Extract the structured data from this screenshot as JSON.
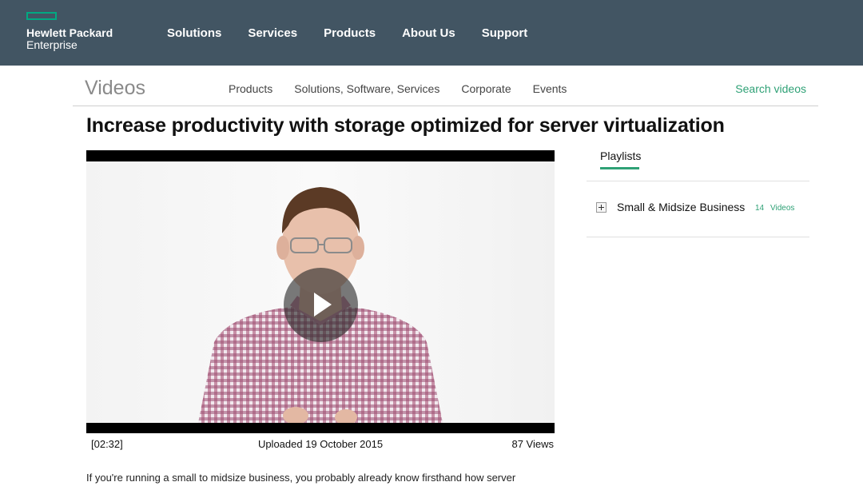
{
  "header": {
    "logo_line1": "Hewlett Packard",
    "logo_line2": "Enterprise",
    "nav": [
      "Solutions",
      "Services",
      "Products",
      "About Us",
      "Support"
    ]
  },
  "subnav": {
    "title": "Videos",
    "links": [
      "Products",
      "Solutions, Software, Services",
      "Corporate",
      "Events"
    ],
    "search_label": "Search videos"
  },
  "video": {
    "title": "Increase productivity with storage optimized for server virtualization",
    "duration": "[02:32]",
    "uploaded": "Uploaded 19 October 2015",
    "views": "87 Views",
    "description": "If you're running a small to midsize business, you probably already know firsthand how server"
  },
  "sidebar": {
    "tab": "Playlists",
    "playlist": {
      "name": "Small & Midsize Business",
      "count": "14",
      "count_label": "Videos"
    }
  },
  "colors": {
    "header_bg": "#425563",
    "accent_green": "#2fa176",
    "brand_green": "#01a982"
  },
  "icons": {
    "play": "play-icon",
    "expand": "plus-box-icon",
    "logo": "hpe-logo-rectangle"
  }
}
